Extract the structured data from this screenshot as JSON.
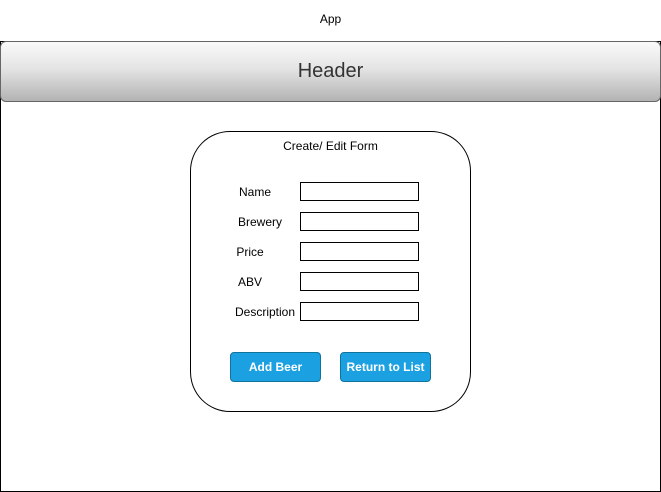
{
  "app": {
    "title": "App"
  },
  "header": {
    "title": "Header"
  },
  "form": {
    "title": "Create/ Edit Form",
    "fields": [
      {
        "label": "Name",
        "value": ""
      },
      {
        "label": "Brewery",
        "value": ""
      },
      {
        "label": "Price",
        "value": ""
      },
      {
        "label": "ABV",
        "value": ""
      },
      {
        "label": "Description",
        "value": ""
      }
    ],
    "buttons": {
      "add": "Add Beer",
      "return": "Return to List"
    }
  },
  "colors": {
    "button_fill": "#1ba1e2",
    "button_border": "#10739e",
    "button_text": "#ffffff",
    "header_gradient_top": "#fafafa",
    "header_gradient_bottom": "#b3b3b3"
  }
}
